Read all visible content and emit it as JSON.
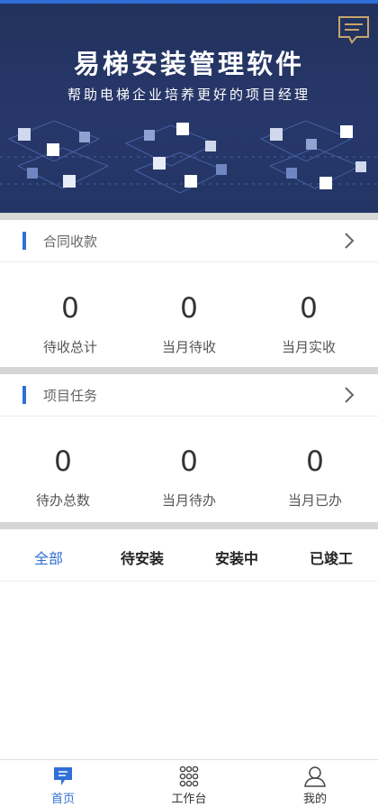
{
  "banner": {
    "title": "易梯安装管理软件",
    "subtitle": "帮助电梯企业培养更好的项目经理",
    "message_icon": "message-icon"
  },
  "contract": {
    "title": "合同收款",
    "stats": [
      {
        "value": "0",
        "label": "待收总计"
      },
      {
        "value": "0",
        "label": "当月待收"
      },
      {
        "value": "0",
        "label": "当月实收"
      }
    ]
  },
  "project": {
    "title": "项目任务",
    "stats": [
      {
        "value": "0",
        "label": "待办总数"
      },
      {
        "value": "0",
        "label": "当月待办"
      },
      {
        "value": "0",
        "label": "当月已办"
      }
    ]
  },
  "tabs": [
    {
      "label": "全部",
      "active": true
    },
    {
      "label": "待安装"
    },
    {
      "label": "安装中"
    },
    {
      "label": "已竣工"
    }
  ],
  "bottom_nav": [
    {
      "label": "首页",
      "icon": "home-chat-icon",
      "active": true
    },
    {
      "label": "工作台",
      "icon": "grid-icon"
    },
    {
      "label": "我的",
      "icon": "user-icon"
    }
  ],
  "colors": {
    "accent": "#2f6fd6",
    "banner_bg": "#27376a",
    "separator": "#d6d6d6"
  }
}
